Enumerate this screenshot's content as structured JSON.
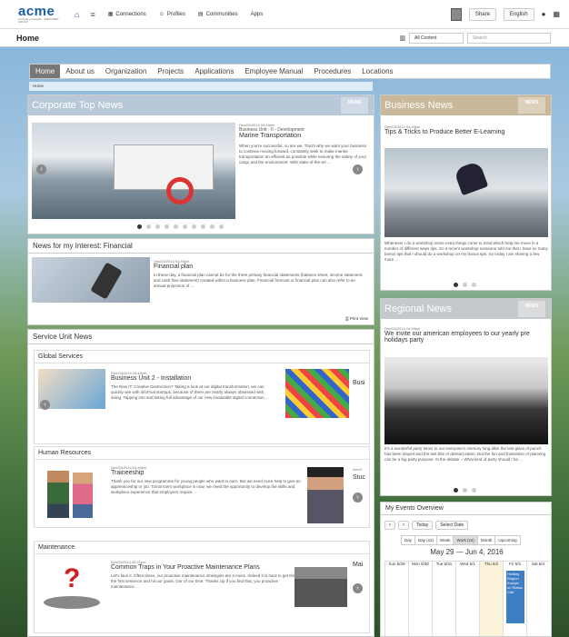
{
  "topbar": {
    "logo": "acme",
    "logo_sub": "innovate renewable · EMPOWER GROUP",
    "links": [
      "Connections",
      "Profiles",
      "Communities",
      "Apps"
    ],
    "share": "Share",
    "language": "English"
  },
  "titlebar": {
    "title": "Home",
    "scope": "All Content",
    "search_placeholder": "Search"
  },
  "nav": [
    "Home",
    "About us",
    "Organization",
    "Projects",
    "Applications",
    "Employee Manual",
    "Procedures",
    "Locations"
  ],
  "breadcrumb": "Home",
  "corp": {
    "title": "Corporate Top News",
    "tag": "NEWS",
    "date": "Dec/04/2014 04:49pm",
    "category": "Business Unit - II - Development",
    "headline": "Marine Transportation",
    "body": "When you're successful, so are we. That's why we want your business to continue moving forward, constantly seek to make marine transportation an efficient as possible while ensuring the safety of your cargo and the environment. With state-of-the-art ..."
  },
  "interest": {
    "title": "News for my Interest: Financial",
    "date": "Dec/02/2014 04:49pm",
    "headline": "Financial plan",
    "body": "In these day, a financial plan cannot be for the three primary financial statements (balance sheet, income statement, and cash flow statement) created within a business plan. Financial forecast or financial plan can also refer to an annual projection of ...",
    "print": "Print View"
  },
  "sun": {
    "title": "Service Unit News",
    "global": {
      "label": "Global Services",
      "date": "Dec/03/2014 03:49pm",
      "category": "Business Unit 2 - Installation",
      "body": "The New IT: Creative Destruction? Taking a look at our digital transformation, we can quickly see with informal startups, because of there are nearly always obsessed with doing. Tapping into and taking full advantage of our new invaluable digital connection ...",
      "right": "Busi"
    },
    "hr": {
      "label": "Human Resources",
      "date": "Nov/03/2014 04:49pm",
      "headline": "Traineeship",
      "body": "Thank you for our new programme for young people who want to earn. But we need more help to give an apprenticeship or job. Tomorrow's workplace is now; we need the opportunity to develop the skills and workplace experience that employers require ...",
      "right": "Stuc",
      "right_date": "Nov/0"
    },
    "maint": {
      "label": "Maintenance",
      "date": "Apr/03/2014 05:22pm",
      "headline": "Common Traps in Your Proactive Maintenance Plans",
      "body": "Let's face it. Often times, our proactive maintenance strategies are a mess. Indeed it is hard to get this in the first sentence and hit our goals. Our of our time. Thanks Up if you find that, you proactive maintenance ...",
      "right": "Mai"
    }
  },
  "business": {
    "title": "Business News",
    "tag": "NEWS",
    "date": "Dec/03/2014 04:49pm",
    "headline": "Tips & Tricks to Produce Better E-Learning",
    "body": "Whenever I do a workshop some extra things come to mind which help me move in a number of different ways tips. So a recent workshop someone told me that I have so many bonus tips that I should do a workshop on my bonus tips. So today I am sharing a few more ..."
  },
  "regional": {
    "title": "Regional News",
    "tag": "NEWS",
    "date": "Dec/02/2014 04:49pm",
    "headline": "We invite our american employees to our yearly pre holidays party",
    "body": "It's a wonderful party times to our everyone's memory long after the last glass of punch has been stayed and the last bite of dessert eaten. But the fun and frustration of planning can be a big party purpose. At the debate – What kind of party should I ha ..."
  },
  "events": {
    "title": "My Events Overview",
    "today": "Today",
    "select_date": "Select Date",
    "views": [
      "Day",
      "Day (x2)",
      "Week",
      "Work (x2)",
      "Month",
      "Upcoming"
    ],
    "range": "May 29 — Jun 4, 2016",
    "days": [
      "Sun 5/29",
      "Mon 5/30",
      "Tue 5/31",
      "Wed 6/1",
      "Thu 6/2",
      "Fri 6/3",
      "Sat 6/4"
    ],
    "event": "Holiday Region Europe on Status Call"
  }
}
